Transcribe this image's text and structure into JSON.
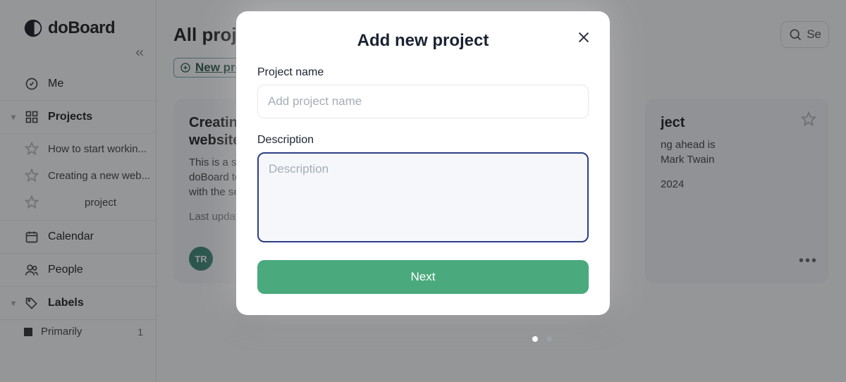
{
  "brand": {
    "name": "doBoard"
  },
  "sidebar": {
    "me": "Me",
    "projects": "Projects",
    "items": [
      {
        "label": "How to start workin..."
      },
      {
        "label": "Creating a new web..."
      },
      {
        "label": "project"
      }
    ],
    "calendar": "Calendar",
    "people": "People",
    "labels": "Labels",
    "label_primary": "Primarily",
    "label_primary_count": "1"
  },
  "header": {
    "title": "All projects",
    "search_placeholder": "Se"
  },
  "new_project_link": "New project",
  "cards": [
    {
      "title": "Creating a new website(Example)",
      "desc": "This is a small example of using doBoard to familiarize yourself with the service's capabilities.",
      "last_update": "Last update",
      "avatar": "TR"
    },
    {
      "title_suffix": "ject",
      "desc_line1": "ng ahead is",
      "desc_line2": "Mark Twain",
      "year": "2024"
    }
  ],
  "modal": {
    "title": "Add new project",
    "project_name_label": "Project name",
    "project_name_placeholder": "Add project name",
    "description_label": "Description",
    "description_placeholder": "Description",
    "next": "Next"
  }
}
